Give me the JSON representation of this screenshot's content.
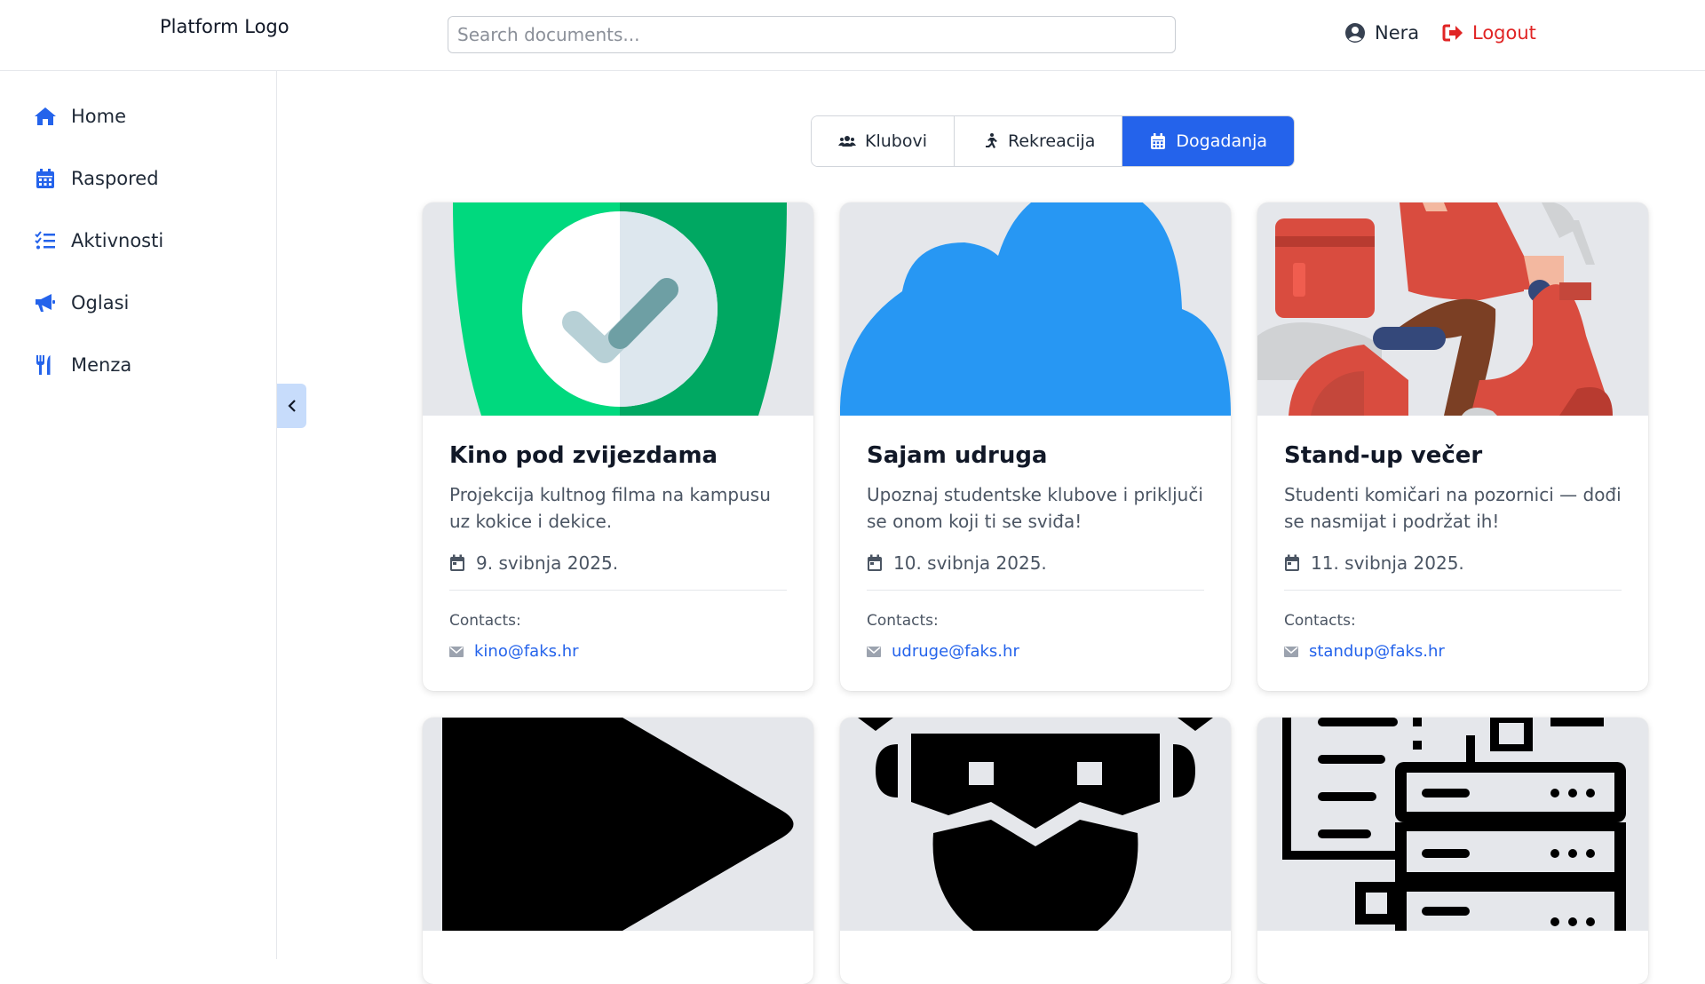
{
  "header": {
    "logo_text": "Platform Logo",
    "search_placeholder": "Search documents...",
    "user_name": "Nera",
    "logout_label": "Logout"
  },
  "sidebar": {
    "items": [
      {
        "label": "Home",
        "icon": "home-icon"
      },
      {
        "label": "Raspored",
        "icon": "calendar-icon"
      },
      {
        "label": "Aktivnosti",
        "icon": "list-check-icon"
      },
      {
        "label": "Oglasi",
        "icon": "megaphone-icon"
      },
      {
        "label": "Menza",
        "icon": "utensils-icon"
      }
    ],
    "collapse_icon": "chevron-left-icon"
  },
  "tabs": [
    {
      "label": "Klubovi",
      "icon": "users-icon",
      "active": false
    },
    {
      "label": "Rekreacija",
      "icon": "running-icon",
      "active": false
    },
    {
      "label": "Dogadanja",
      "icon": "calendar-icon",
      "active": true
    }
  ],
  "cards": [
    {
      "title": "Kino pod zvijezdama",
      "description": "Projekcija kultnog filma na kampusu uz kokice i dekice.",
      "date": "9. svibnja 2025.",
      "contacts_label": "Contacts:",
      "email": "kino@faks.hr",
      "image_icon": "shield-check-icon"
    },
    {
      "title": "Sajam udruga",
      "description": "Upoznaj studentske klubove i priključi se onom koji ti se sviđa!",
      "date": "10. svibnja 2025.",
      "contacts_label": "Contacts:",
      "email": "udruge@faks.hr",
      "image_icon": "cloud-icon"
    },
    {
      "title": "Stand-up večer",
      "description": "Studenti komičari na pozornici — dođi se nasmijat i podržat ih!",
      "date": "11. svibnja 2025.",
      "contacts_label": "Contacts:",
      "email": "standup@faks.hr",
      "image_icon": "delivery-scooter-icon"
    },
    {
      "image_icon": "play-icon"
    },
    {
      "image_icon": "robot-icon"
    },
    {
      "image_icon": "server-list-icon"
    }
  ],
  "colors": {
    "accent": "#2463eb",
    "logout": "#e02424",
    "collapse_bg": "#c7dcfb"
  }
}
